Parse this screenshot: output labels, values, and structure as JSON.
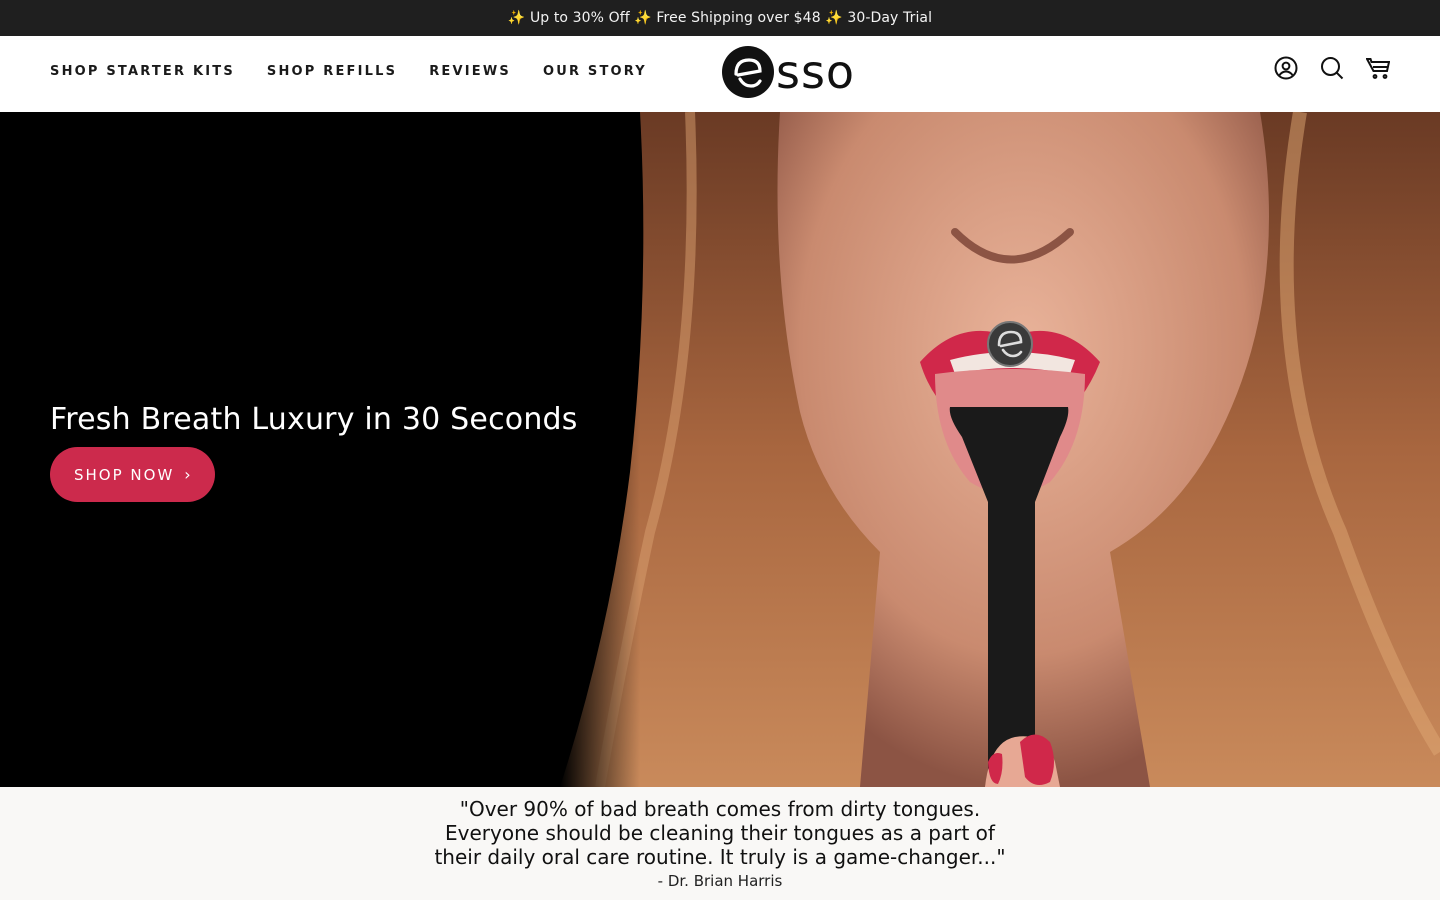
{
  "announcement": "✨ Up to 30% Off ✨ Free Shipping over $48 ✨ 30-Day Trial",
  "nav": [
    {
      "label": "SHOP STARTER KITS",
      "name": "nav-shop-starter-kits"
    },
    {
      "label": "SHOP REFILLS",
      "name": "nav-shop-refills"
    },
    {
      "label": "REVIEWS",
      "name": "nav-reviews"
    },
    {
      "label": "OUR STORY",
      "name": "nav-our-story"
    }
  ],
  "logo": {
    "text": "sso",
    "icon": "esso-logo-mark"
  },
  "header_icons": [
    "account-icon",
    "search-icon",
    "cart-icon"
  ],
  "hero": {
    "title": "Fresh Breath Luxury in 30 Seconds",
    "cta": "SHOP NOW",
    "cta_icon": "›"
  },
  "quote": {
    "text": "\"Over 90% of bad breath comes from dirty tongues. Everyone should be cleaning their tongues as a part of their daily oral care routine. It truly is a game-changer...\"",
    "author": "- Dr. Brian Harris"
  },
  "colors": {
    "accent": "#cc2a4c",
    "announce_bg": "#1f1f1f",
    "quote_bg": "#f9f8f6"
  }
}
